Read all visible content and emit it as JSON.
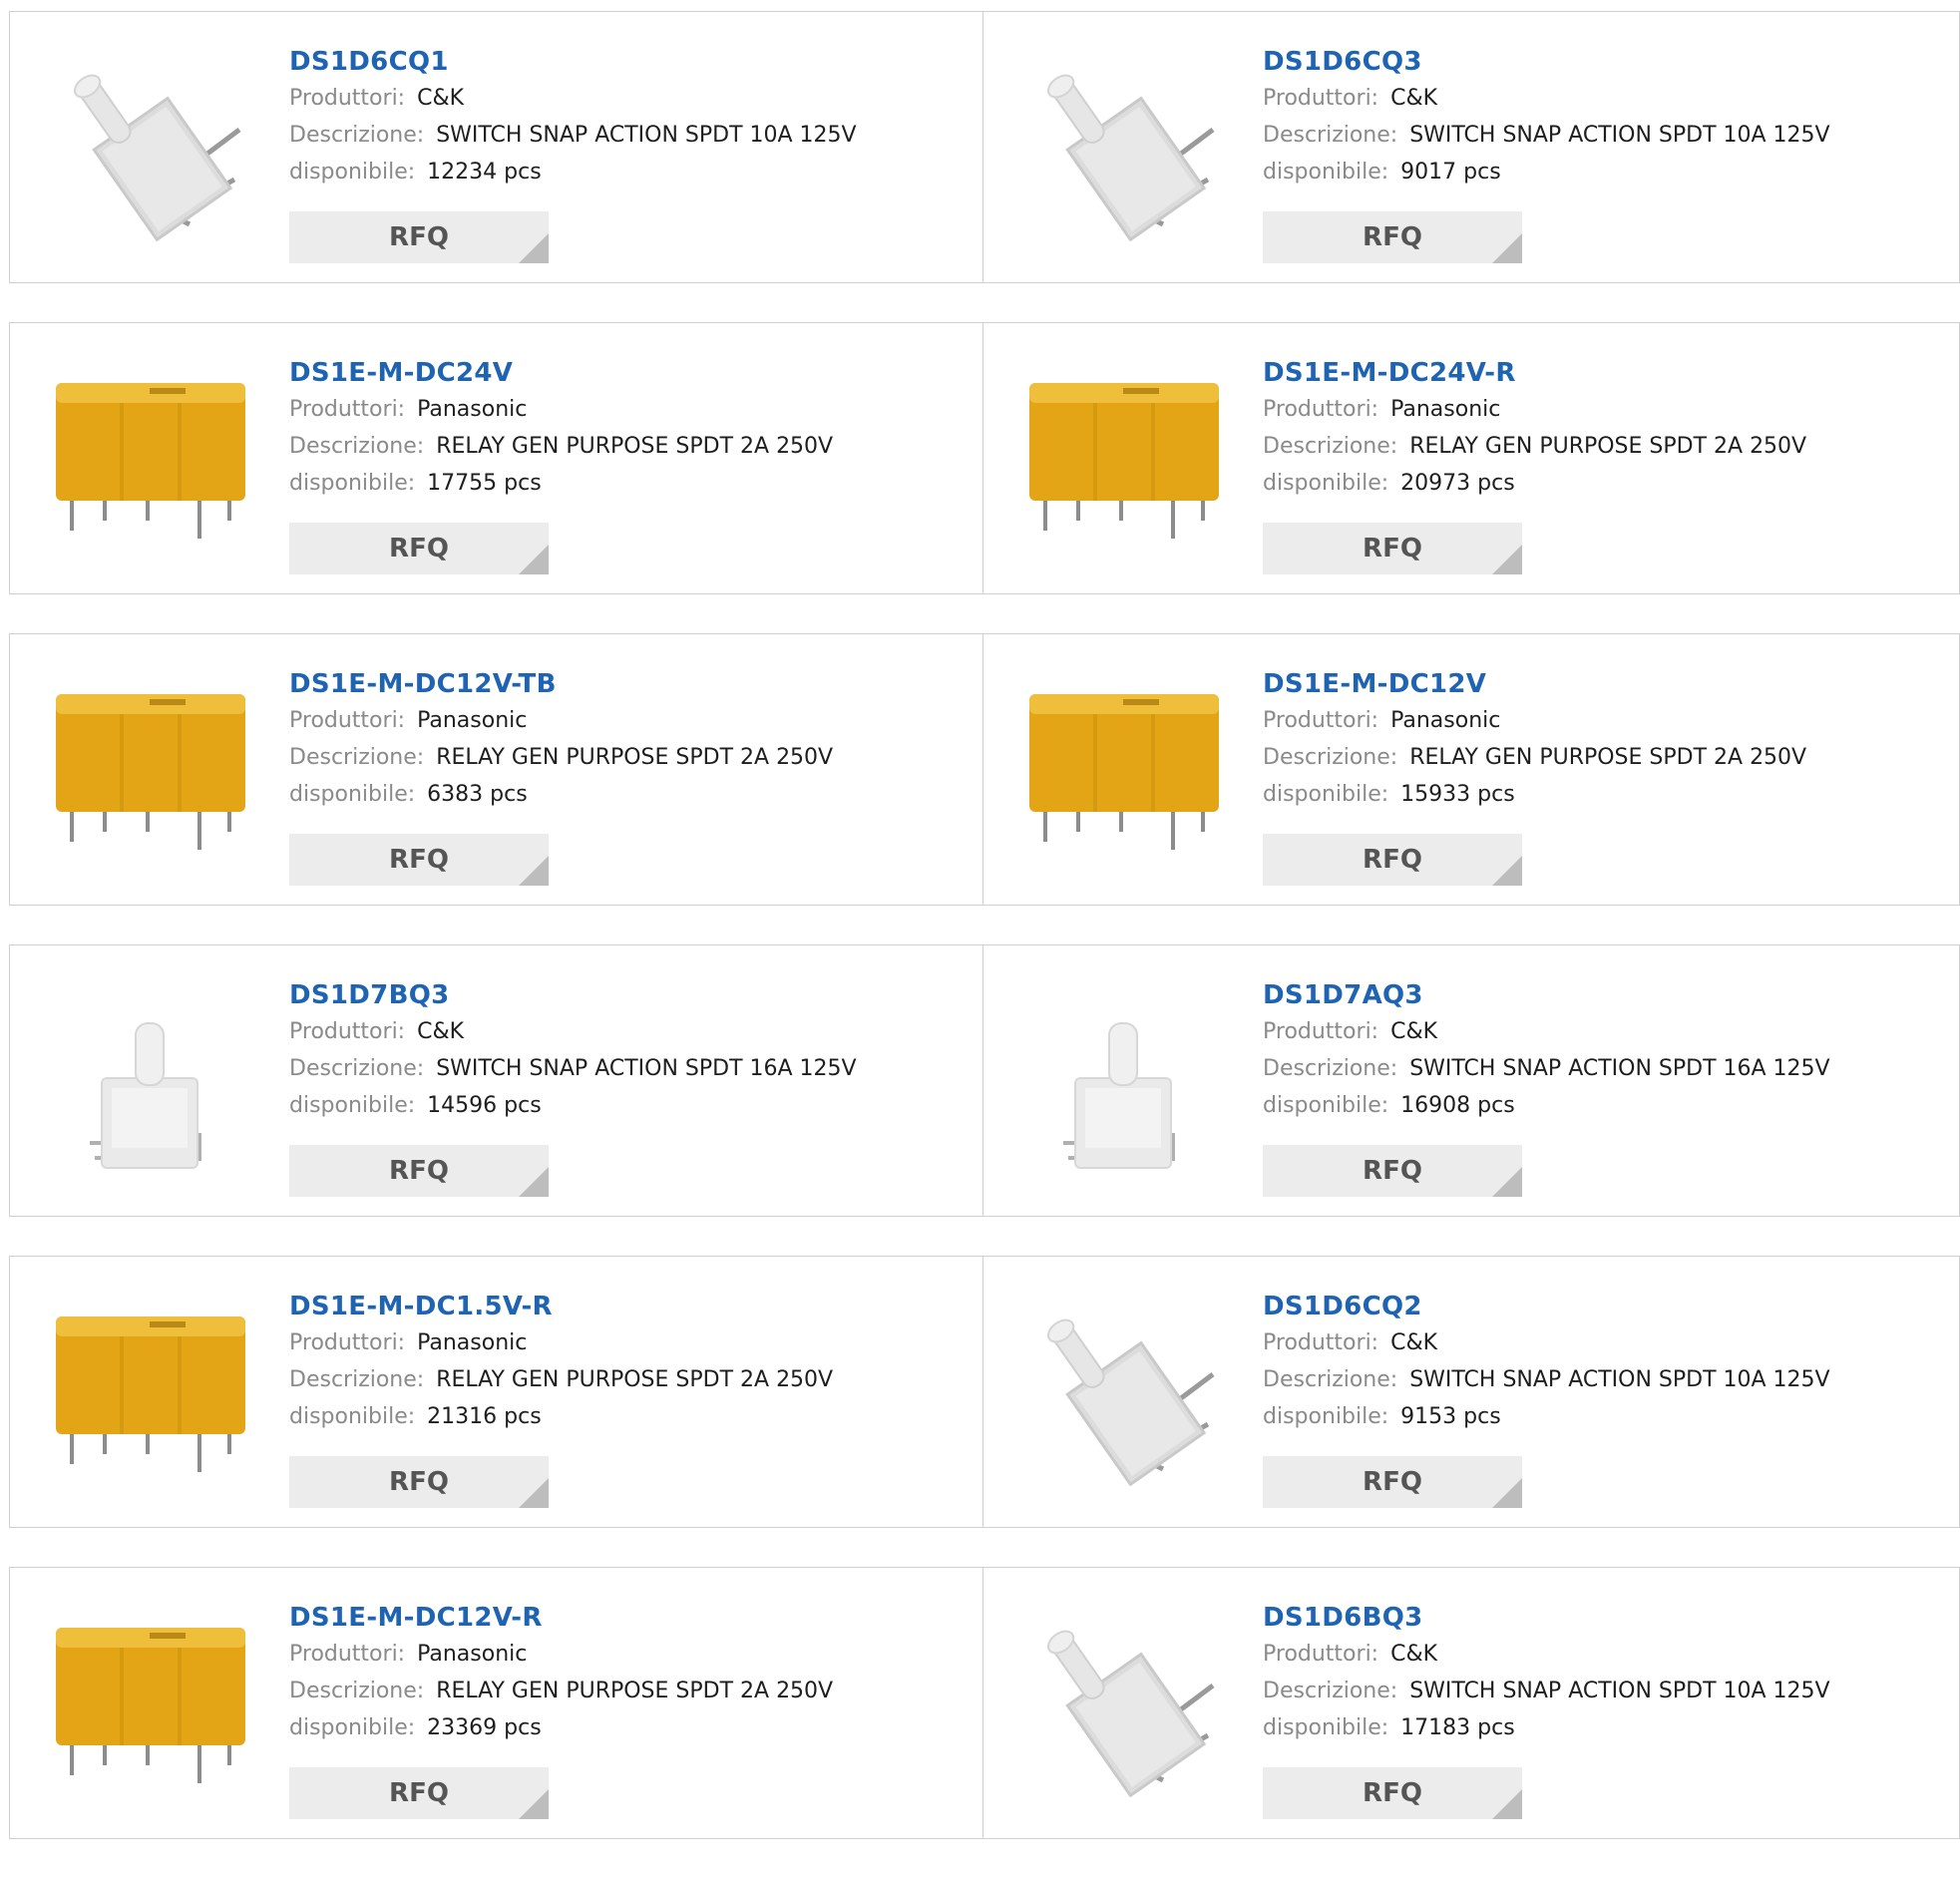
{
  "labels": {
    "manufacturer": "Produttori:",
    "description": "Descrizione:",
    "available": "disponibile:",
    "rfq": "RFQ"
  },
  "products": [
    {
      "part": "DS1D6CQ1",
      "manufacturer": "C&K",
      "description": "SWITCH SNAP ACTION SPDT 10A 125V",
      "stock": "12234 pcs",
      "image": "switch-angled"
    },
    {
      "part": "DS1D6CQ3",
      "manufacturer": "C&K",
      "description": "SWITCH SNAP ACTION SPDT 10A 125V",
      "stock": "9017 pcs",
      "image": "switch-angled"
    },
    {
      "part": "DS1E-M-DC24V",
      "manufacturer": "Panasonic",
      "description": "RELAY GEN PURPOSE SPDT 2A 250V",
      "stock": "17755 pcs",
      "image": "relay-yellow"
    },
    {
      "part": "DS1E-M-DC24V-R",
      "manufacturer": "Panasonic",
      "description": "RELAY GEN PURPOSE SPDT 2A 250V",
      "stock": "20973 pcs",
      "image": "relay-yellow"
    },
    {
      "part": "DS1E-M-DC12V-TB",
      "manufacturer": "Panasonic",
      "description": "RELAY GEN PURPOSE SPDT 2A 250V",
      "stock": "6383 pcs",
      "image": "relay-yellow"
    },
    {
      "part": "DS1E-M-DC12V",
      "manufacturer": "Panasonic",
      "description": "RELAY GEN PURPOSE SPDT 2A 250V",
      "stock": "15933 pcs",
      "image": "relay-yellow"
    },
    {
      "part": "DS1D7BQ3",
      "manufacturer": "C&K",
      "description": "SWITCH SNAP ACTION SPDT 16A 125V",
      "stock": "14596 pcs",
      "image": "switch-upright"
    },
    {
      "part": "DS1D7AQ3",
      "manufacturer": "C&K",
      "description": "SWITCH SNAP ACTION SPDT 16A 125V",
      "stock": "16908 pcs",
      "image": "switch-upright"
    },
    {
      "part": "DS1E-M-DC1.5V-R",
      "manufacturer": "Panasonic",
      "description": "RELAY GEN PURPOSE SPDT 2A 250V",
      "stock": "21316 pcs",
      "image": "relay-yellow"
    },
    {
      "part": "DS1D6CQ2",
      "manufacturer": "C&K",
      "description": "SWITCH SNAP ACTION SPDT 10A 125V",
      "stock": "9153 pcs",
      "image": "switch-angled"
    },
    {
      "part": "DS1E-M-DC12V-R",
      "manufacturer": "Panasonic",
      "description": "RELAY GEN PURPOSE SPDT 2A 250V",
      "stock": "23369 pcs",
      "image": "relay-yellow"
    },
    {
      "part": "DS1D6BQ3",
      "manufacturer": "C&K",
      "description": "SWITCH SNAP ACTION SPDT 10A 125V",
      "stock": "17183 pcs",
      "image": "switch-angled"
    }
  ],
  "colors": {
    "title": "#1f64b3",
    "label": "#8a8a8a",
    "value": "#1e1e1e",
    "relay": "#e3a515",
    "button_bg": "#ececec"
  }
}
